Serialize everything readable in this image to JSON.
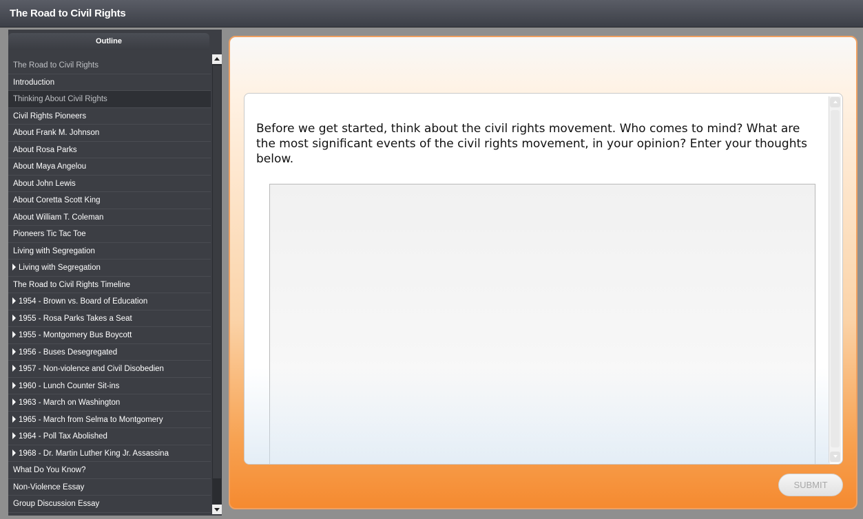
{
  "window": {
    "title": "The Road to Civil Rights"
  },
  "sidebar": {
    "tab_label": "Outline",
    "items": [
      {
        "label": "The Road to Civil Rights",
        "arrow": false
      },
      {
        "label": "Introduction",
        "arrow": false
      },
      {
        "label": "Thinking About Civil Rights",
        "arrow": false,
        "selected": true
      },
      {
        "label": "Civil Rights Pioneers",
        "arrow": false
      },
      {
        "label": "About Frank M. Johnson",
        "arrow": false
      },
      {
        "label": "About Rosa Parks",
        "arrow": false
      },
      {
        "label": "About Maya Angelou",
        "arrow": false
      },
      {
        "label": "About John Lewis",
        "arrow": false
      },
      {
        "label": "About Coretta Scott King",
        "arrow": false
      },
      {
        "label": "About William T. Coleman",
        "arrow": false
      },
      {
        "label": "Pioneers Tic Tac Toe",
        "arrow": false
      },
      {
        "label": "Living with Segregation",
        "arrow": false
      },
      {
        "label": "Living with Segregation",
        "arrow": true
      },
      {
        "label": "The Road to Civil Rights Timeline",
        "arrow": false
      },
      {
        "label": "1954 - Brown vs. Board of Education",
        "arrow": true
      },
      {
        "label": "1955 - Rosa Parks Takes a Seat",
        "arrow": true
      },
      {
        "label": "1955 - Montgomery Bus Boycott",
        "arrow": true
      },
      {
        "label": "1956 - Buses Desegregated",
        "arrow": true
      },
      {
        "label": "1957 - Non-violence and Civil Disobedien",
        "arrow": true
      },
      {
        "label": "1960 - Lunch Counter Sit-ins",
        "arrow": true
      },
      {
        "label": "1963 - March on Washington",
        "arrow": true
      },
      {
        "label": "1965 - March from Selma to Montgomery",
        "arrow": true
      },
      {
        "label": "1964 - Poll Tax Abolished",
        "arrow": true
      },
      {
        "label": "1968 - Dr. Martin Luther King Jr. Assassina",
        "arrow": true
      },
      {
        "label": "What Do You Know?",
        "arrow": false
      },
      {
        "label": "Non-Violence Essay",
        "arrow": false
      },
      {
        "label": "Group Discussion Essay",
        "arrow": false
      }
    ]
  },
  "main": {
    "prompt": "Before we get started, think about the civil rights movement. Who comes to mind? What are the most significant events of the civil rights movement, in your opinion? Enter your thoughts below.",
    "answer_value": "",
    "submit_label": "SUBMIT"
  },
  "colors": {
    "titlebar": "#3c3f47",
    "sidebar": "#3c3e44",
    "accent_orange": "#f58a30"
  }
}
